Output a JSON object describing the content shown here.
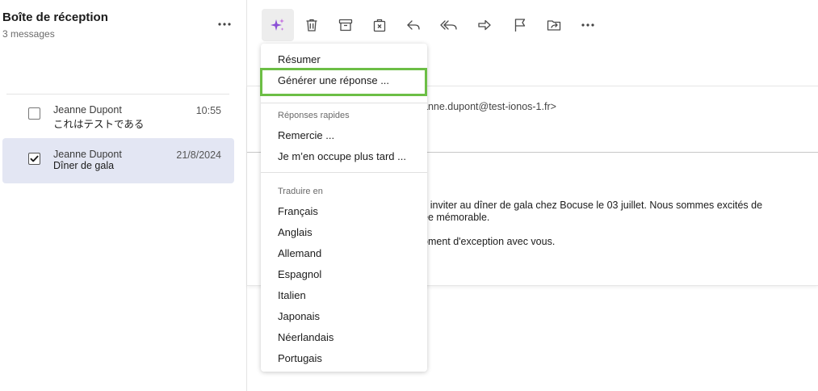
{
  "folder": {
    "title": "Boîte de réception",
    "count": "3 messages",
    "more_icon": "more-horizontal-icon"
  },
  "messages": [
    {
      "sender": "Jeanne Dupont",
      "subject": "これはテストである",
      "time": "10:55",
      "checked": false
    },
    {
      "sender": "Jeanne Dupont",
      "subject": "Dîner de gala",
      "time": "21/8/2024",
      "checked": true
    }
  ],
  "toolbar": {
    "icons": [
      "ai-sparkle-icon",
      "trash-icon",
      "archive-icon",
      "spam-icon",
      "reply-icon",
      "reply-all-icon",
      "forward-icon",
      "flag-icon",
      "move-folder-icon",
      "more-horizontal-icon"
    ],
    "active_color": "#8a4fd6"
  },
  "email": {
    "from_partial": "anne.dupont@test-ionos-1.fr>",
    "body_lines": [
      "s inviter au dîner de gala chez Bocuse le 03 juillet. Nous sommes excités de",
      "ée mémorable.",
      "",
      "oment d'exception avec vous."
    ]
  },
  "menu": {
    "summarize": "Résumer",
    "generate_reply": "Générer une réponse ...",
    "quick_replies_header": "Réponses rapides",
    "quick_replies": [
      "Remercie ...",
      "Je m’en occupe plus tard ..."
    ],
    "translate_header": "Traduire en",
    "languages": [
      "Français",
      "Anglais",
      "Allemand",
      "Espagnol",
      "Italien",
      "Japonais",
      "Néerlandais",
      "Portugais"
    ]
  },
  "colors": {
    "selected_row": "#e3e6f3",
    "highlight": "#6cbe45"
  }
}
